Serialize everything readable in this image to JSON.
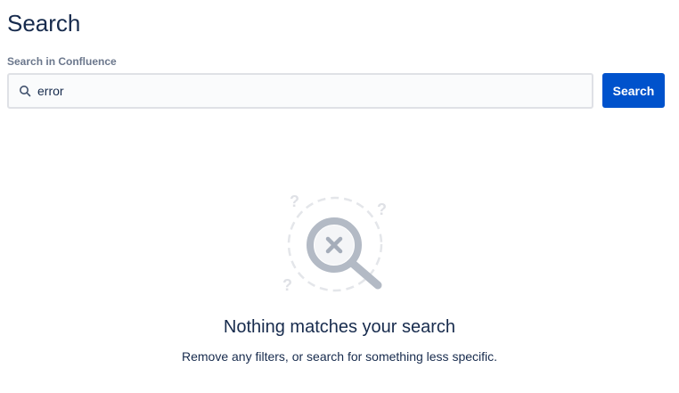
{
  "page": {
    "title": "Search"
  },
  "search": {
    "label": "Search in Confluence",
    "value": "error",
    "placeholder": "",
    "button_label": "Search"
  },
  "empty_state": {
    "title": "Nothing matches your search",
    "description": "Remove any filters, or search for something less specific.",
    "illustration_icon": "no-results-magnifier-icon"
  },
  "colors": {
    "primary": "#0052cc",
    "text": "#172b4d",
    "label": "#6b778c",
    "input_border": "#dfe1e6",
    "input_background": "#fafbfc"
  }
}
